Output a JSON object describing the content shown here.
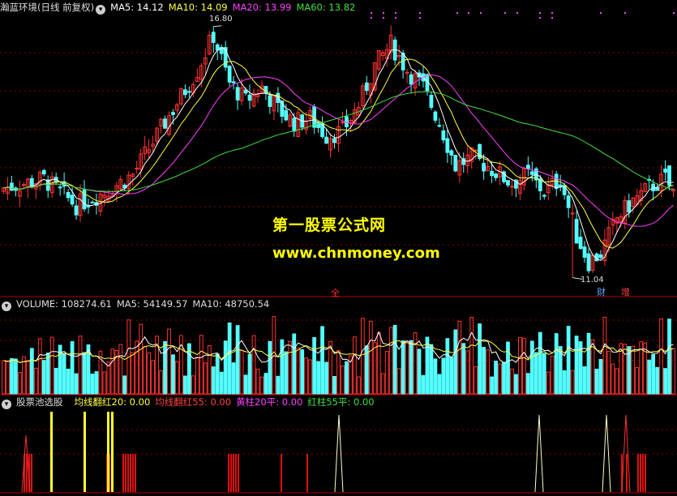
{
  "price_panel": {
    "title": "瀚蓝环境(日线 前复权)",
    "ma5": "MA5: 14.12",
    "ma10": "MA10: 14.09",
    "ma20": "MA20: 13.99",
    "ma60": "MA60: 13.82",
    "high_label": "16.80",
    "low_label": "11.04",
    "marker_cai": "财",
    "marker_zeng": "增",
    "marker_red": "全",
    "watermark_title": "第一股票公式网",
    "watermark_url": "www.chnmoney.com"
  },
  "volume_panel": {
    "volume": "VOLUME: 108274.61",
    "ma5": "MA5: 54149.57",
    "ma10": "MA10: 48750.54"
  },
  "indicator_panel": {
    "name": "股票池选股",
    "s1": "均线翻红20: 0.00",
    "s2": "均线翻红55: 0.00",
    "s3": "黄柱20平: 0.00",
    "s4": "红柱55平: 0.00"
  },
  "colors": {
    "up": "#ff3232",
    "down": "#54ffff",
    "ma5": "#ffffff",
    "ma10": "#ffff40",
    "ma20": "#ff40ff",
    "ma60": "#40e040",
    "separator": "#b00000"
  },
  "chart_data": {
    "type": "candlestick",
    "high": 16.8,
    "low": 11.04,
    "series": [
      {
        "name": "MA5",
        "last": 14.12
      },
      {
        "name": "MA10",
        "last": 14.09
      },
      {
        "name": "MA20",
        "last": 13.99
      },
      {
        "name": "MA60",
        "last": 13.82
      }
    ]
  }
}
